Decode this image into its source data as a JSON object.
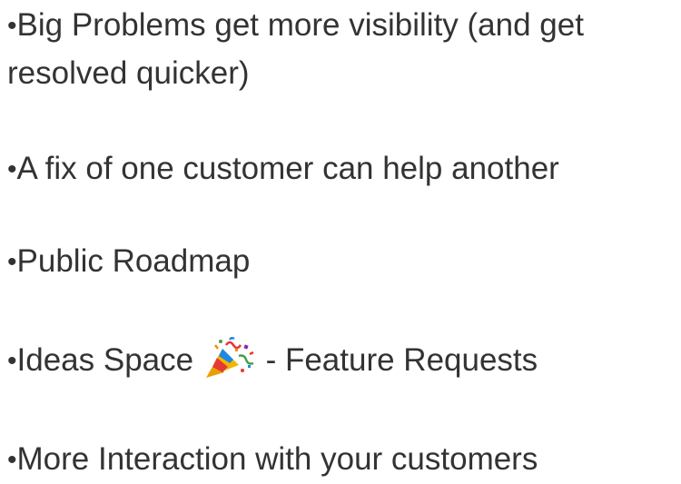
{
  "bullets": [
    {
      "text": "Big Problems get more visibility (and get resolved quicker)"
    },
    {
      "text": "A fix of one customer can help another"
    },
    {
      "text": "Public Roadmap"
    },
    {
      "text_before": "Ideas Space",
      "icon": "party-popper-icon",
      "text_after": " - Feature Requests"
    },
    {
      "text": "More Interaction with your customers"
    }
  ],
  "bullet_glyph": "•",
  "colors": {
    "text": "#333333",
    "background": "#ffffff"
  }
}
